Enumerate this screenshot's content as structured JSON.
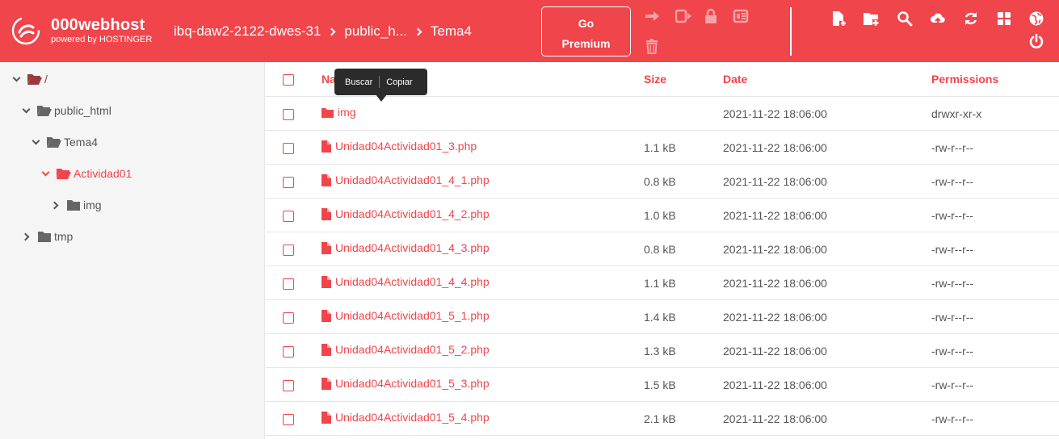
{
  "header": {
    "brand_name": "000webhost",
    "brand_sub": "powered by HOSTINGER",
    "breadcrumbs": [
      "ibq-daw2-2122-dwes-31",
      "public_h...",
      "Tema4"
    ],
    "premium_line1": "Go",
    "premium_line2": "Premium",
    "accent": "#f0454b"
  },
  "toolbar_icons": [
    "move-icon",
    "rename-icon",
    "lock-icon",
    "archive-icon",
    "delete-icon",
    "new-file-icon",
    "new-folder-icon",
    "search-icon",
    "upload-icon",
    "refresh-icon",
    "view-grid-icon",
    "globe-icon",
    "power-icon"
  ],
  "sidebar": {
    "tree": [
      {
        "label": "/",
        "state": "expanded"
      },
      {
        "label": "public_html",
        "state": "expanded"
      },
      {
        "label": "Tema4",
        "state": "expanded"
      },
      {
        "label": "Actividad01",
        "state": "expanded-active"
      },
      {
        "label": "img",
        "state": "collapsed"
      },
      {
        "label": "tmp",
        "state": "collapsed"
      }
    ]
  },
  "tooltip": {
    "search": "Buscar",
    "copy": "Copiar"
  },
  "table": {
    "columns": {
      "name": "Name",
      "size": "Size",
      "date": "Date",
      "permissions": "Permissions"
    },
    "rows": [
      {
        "type": "folder",
        "name": "img",
        "size": "",
        "date": "2021-11-22 18:06:00",
        "perms": "drwxr-xr-x"
      },
      {
        "type": "file",
        "name": "Unidad04Actividad01_3.php",
        "size": "1.1 kB",
        "date": "2021-11-22 18:06:00",
        "perms": "-rw-r--r--"
      },
      {
        "type": "file",
        "name": "Unidad04Actividad01_4_1.php",
        "size": "0.8 kB",
        "date": "2021-11-22 18:06:00",
        "perms": "-rw-r--r--"
      },
      {
        "type": "file",
        "name": "Unidad04Actividad01_4_2.php",
        "size": "1.0 kB",
        "date": "2021-11-22 18:06:00",
        "perms": "-rw-r--r--"
      },
      {
        "type": "file",
        "name": "Unidad04Actividad01_4_3.php",
        "size": "0.8 kB",
        "date": "2021-11-22 18:06:00",
        "perms": "-rw-r--r--"
      },
      {
        "type": "file",
        "name": "Unidad04Actividad01_4_4.php",
        "size": "1.1 kB",
        "date": "2021-11-22 18:06:00",
        "perms": "-rw-r--r--"
      },
      {
        "type": "file",
        "name": "Unidad04Actividad01_5_1.php",
        "size": "1.4 kB",
        "date": "2021-11-22 18:06:00",
        "perms": "-rw-r--r--"
      },
      {
        "type": "file",
        "name": "Unidad04Actividad01_5_2.php",
        "size": "1.3 kB",
        "date": "2021-11-22 18:06:00",
        "perms": "-rw-r--r--"
      },
      {
        "type": "file",
        "name": "Unidad04Actividad01_5_3.php",
        "size": "1.5 kB",
        "date": "2021-11-22 18:06:00",
        "perms": "-rw-r--r--"
      },
      {
        "type": "file",
        "name": "Unidad04Actividad01_5_4.php",
        "size": "2.1 kB",
        "date": "2021-11-22 18:06:00",
        "perms": "-rw-r--r--"
      }
    ]
  }
}
